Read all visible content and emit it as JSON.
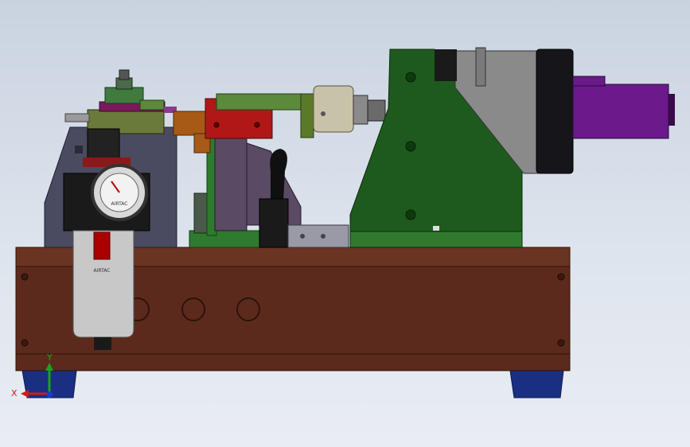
{
  "viewport": {
    "background_top": "#c9d3e0",
    "background_bottom": "#e9edf3"
  },
  "model": {
    "colors": {
      "base": "#5c2a1c",
      "base_top": "#6a3422",
      "feet": "#1a2f82",
      "bracket": "#1e5a1e",
      "bracket_light": "#2f7a2f",
      "spindle": "#8a8a8a",
      "motor_cover": "#16161a",
      "motor": "#6a1a8a",
      "cylinder_block": "#b01818",
      "side_panel": "#4a4a60",
      "regulator_body": "#1a1a1a",
      "filter_bowl": "#c8c8c8",
      "handle": "#101010"
    },
    "labels": {
      "gauge_brand": "AIRTAC",
      "bowl_brand": "AIRTAC"
    }
  },
  "triad": {
    "x_label": "X",
    "y_label": "Y",
    "x_color": "#c81e1e",
    "y_color": "#1ea01e",
    "z_color": "#1e3cc8"
  }
}
